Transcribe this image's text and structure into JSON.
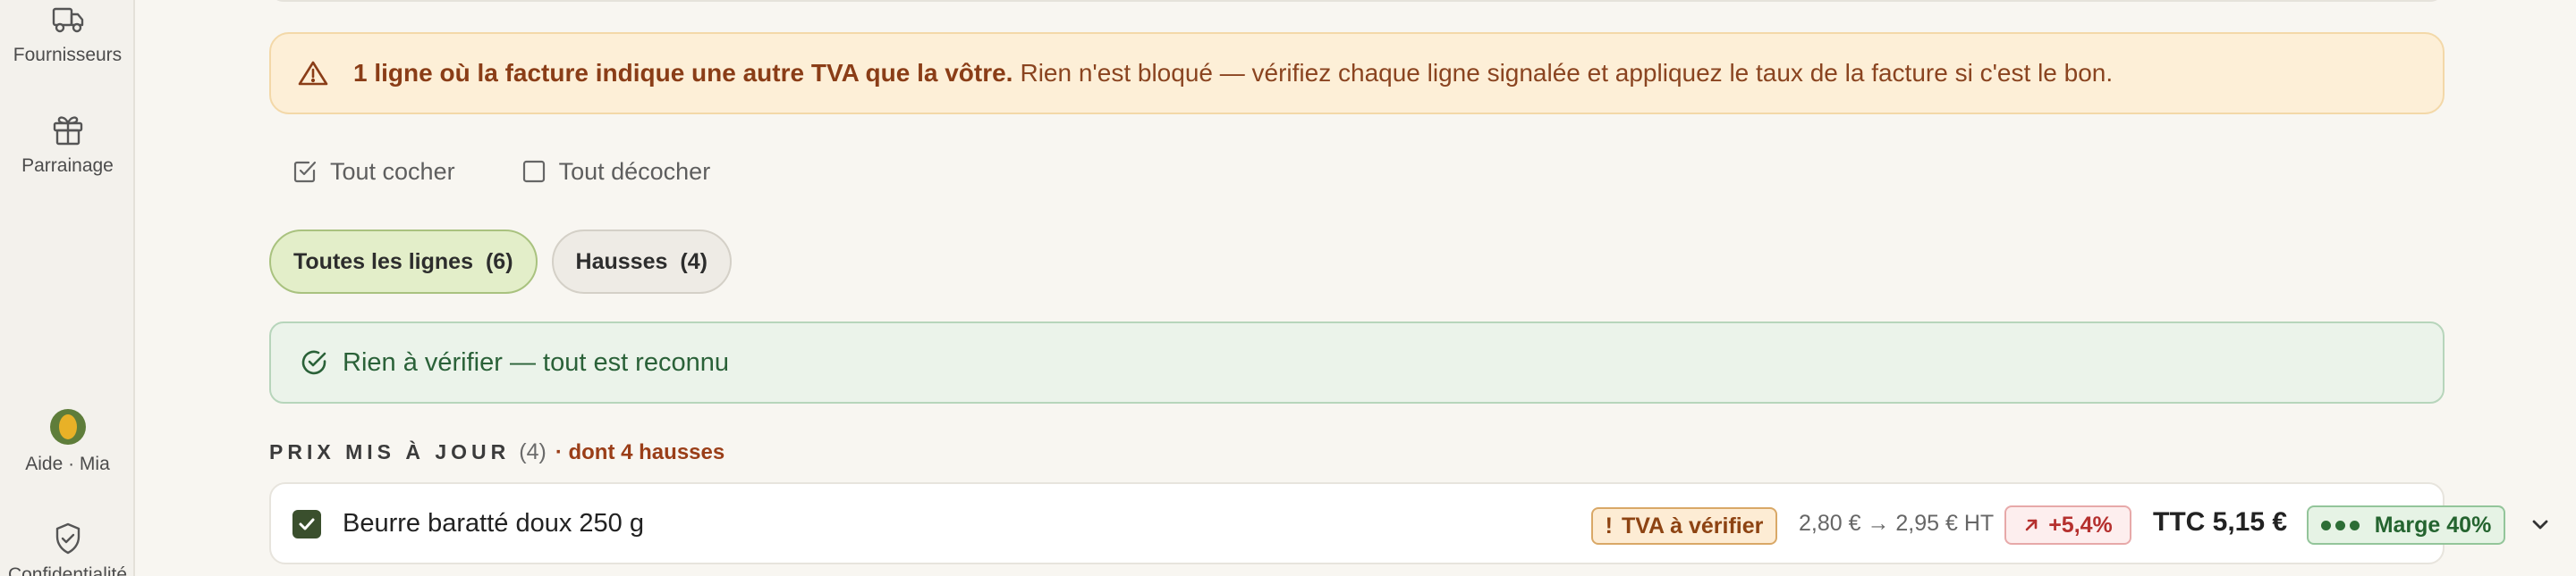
{
  "sidebar": {
    "items": [
      {
        "label": "Fournisseurs",
        "icon": "truck-icon"
      },
      {
        "label": "Parrainage",
        "icon": "gift-icon"
      },
      {
        "label": "Aide · Mia",
        "icon": "mia-avatar-icon"
      },
      {
        "label": "Confidentialité",
        "icon": "shield-check-icon"
      }
    ]
  },
  "alert": {
    "icon": "warning-triangle-icon",
    "strong": "1 ligne où la facture indique une autre TVA que la vôtre.",
    "text": "Rien n'est bloqué — vérifiez chaque ligne signalée et appliquez le taux de la facture si c'est le bon."
  },
  "bulk_actions": {
    "check_all": "Tout cocher",
    "uncheck_all": "Tout décocher"
  },
  "filters": [
    {
      "label": "Toutes les lignes",
      "count": "(6)",
      "active": true
    },
    {
      "label": "Hausses",
      "count": "(4)",
      "active": false
    }
  ],
  "ok_banner": {
    "icon": "check-circle-icon",
    "text": "Rien à vérifier — tout est reconnu"
  },
  "section": {
    "title": "PRIX MIS À JOUR",
    "count": "(4)",
    "note": "· dont 4 hausses"
  },
  "rows": [
    {
      "name": "Beurre baratté doux 250 g",
      "checked": true,
      "vat_badge": "TVA à vérifier",
      "vat_badge_mark": "!",
      "price_change": "2,80 € → 2,95 € HT",
      "delta": "+5,4%",
      "ttc": "TTC 5,15 €",
      "margin": "Marge 40%",
      "margin_dots": 3
    }
  ],
  "colors": {
    "accent_green": "#3a4f2d",
    "warning_bg": "#fdefd7",
    "success_bg": "#ebf3ea",
    "danger": "#b5302e"
  }
}
